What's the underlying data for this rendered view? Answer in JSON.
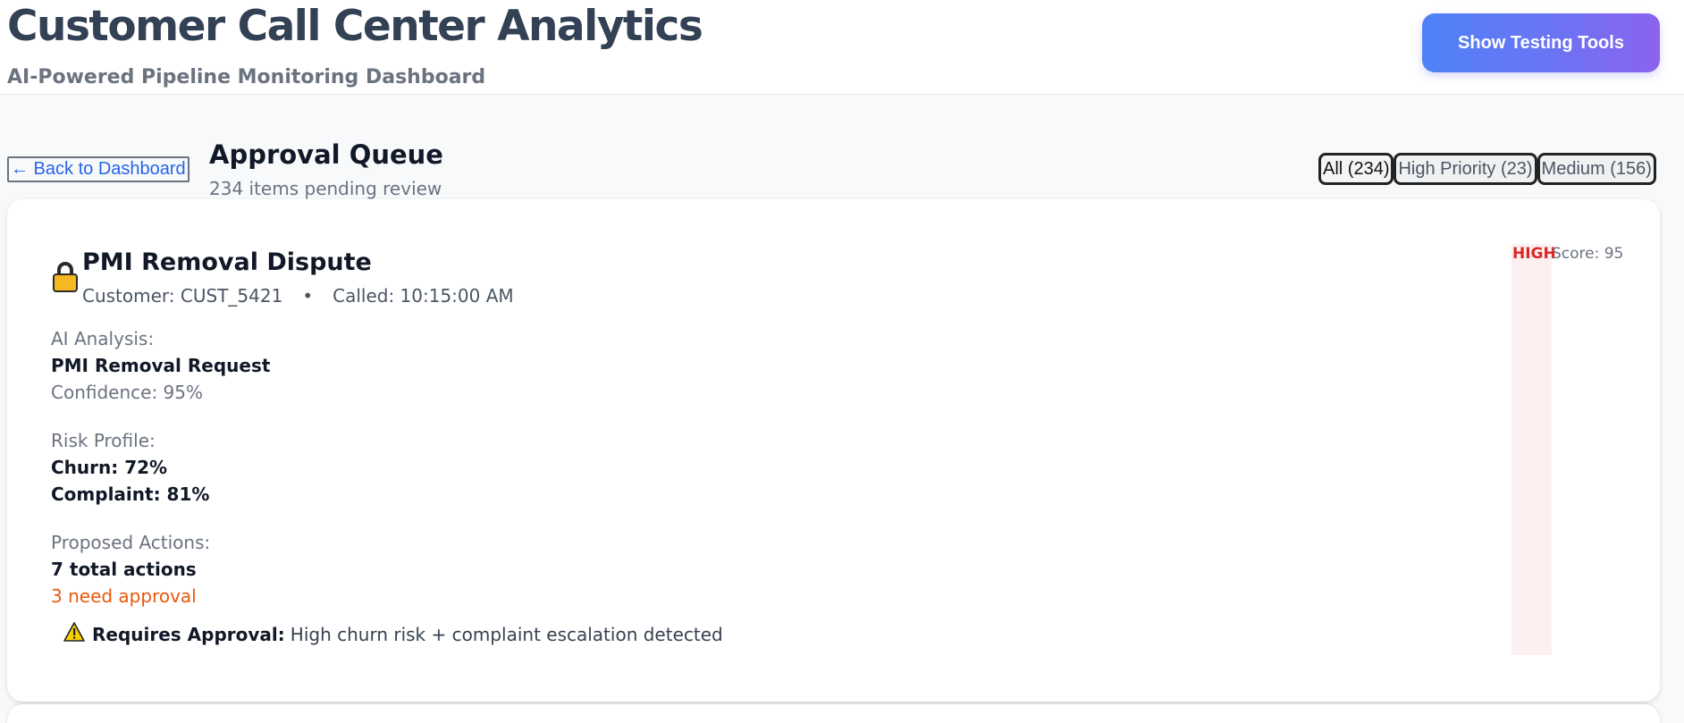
{
  "header": {
    "title": "Customer Call Center Analytics",
    "subtitle": "AI-Powered Pipeline Monitoring Dashboard",
    "testing_button": "Show Testing Tools"
  },
  "queue": {
    "back_label": "← Back to Dashboard",
    "title": "Approval Queue",
    "count_text": "234 items pending review",
    "filters": [
      {
        "label": "All (234)",
        "active": true
      },
      {
        "label": "High Priority (23)",
        "active": false
      },
      {
        "label": "Medium (156)",
        "active": false
      }
    ]
  },
  "card": {
    "icon": "lock-icon",
    "title": "PMI Removal Dispute",
    "customer": "Customer: CUST_5421",
    "separator": "•",
    "called": "Called: 10:15:00 AM",
    "ai_label": "AI Analysis:",
    "ai_value": "PMI Removal Request",
    "confidence": "Confidence: 95%",
    "risk_label": "Risk Profile:",
    "churn": "Churn: 72%",
    "complaint": "Complaint: 81%",
    "actions_label": "Proposed Actions:",
    "actions_total": "7 total actions",
    "actions_need": "3 need approval",
    "approval_bold": "Requires Approval:",
    "approval_text": "High churn risk + complaint escalation detected",
    "priority": "HIGH",
    "score": "Score: 95",
    "colors": {
      "priority": "#dc2626",
      "needs_approval": "#ea580c",
      "link": "#2563eb"
    }
  }
}
